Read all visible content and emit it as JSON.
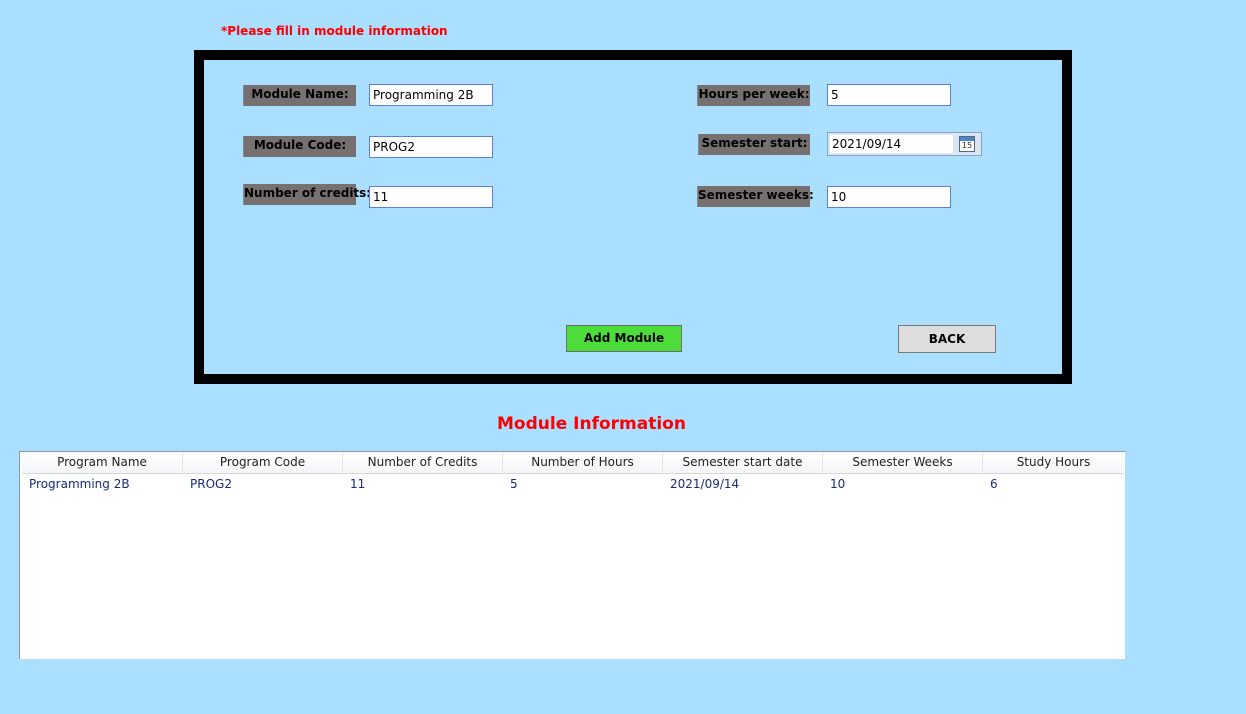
{
  "notice": "*Please fill in module information",
  "form": {
    "module_name": {
      "label": "Module Name:",
      "value": "Programming 2B"
    },
    "module_code": {
      "label": "Module Code:",
      "value": "PROG2"
    },
    "credits": {
      "label": "Number of credits:",
      "value": "11"
    },
    "hours_per_week": {
      "label": "Hours per week:",
      "value": "5"
    },
    "semester_start": {
      "label": "Semester start:",
      "value": "2021/09/14",
      "calendar_icon_text": "15"
    },
    "semester_weeks": {
      "label": "Semester weeks:",
      "value": "10"
    },
    "add_button": "Add Module",
    "back_button": "BACK"
  },
  "colors": {
    "background": "#aadfff",
    "label_bg": "#777070",
    "add_button_bg": "#4cdd3a",
    "notice_text": "#ff0000"
  },
  "table": {
    "title": "Module Information",
    "columns": [
      "Program Name",
      "Program Code",
      "Number of Credits",
      "Number of Hours",
      "Semester start date",
      "Semester Weeks",
      "Study Hours"
    ],
    "rows": [
      [
        "Programming 2B",
        "PROG2",
        "11",
        "5",
        "2021/09/14",
        "10",
        "6"
      ]
    ]
  }
}
